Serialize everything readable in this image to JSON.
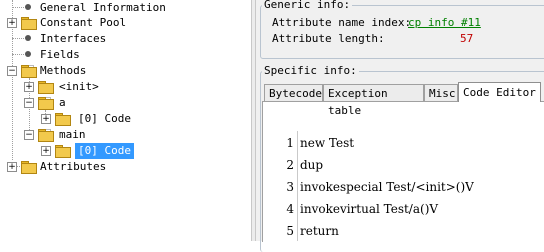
{
  "tree": {
    "items": [
      {
        "label": "General Information"
      },
      {
        "label": "Constant Pool"
      },
      {
        "label": "Interfaces"
      },
      {
        "label": "Fields"
      },
      {
        "label": "Methods"
      },
      {
        "label": "<init>"
      },
      {
        "label": "a"
      },
      {
        "label": "[0] Code"
      },
      {
        "label": "main"
      },
      {
        "label": "[0] Code"
      },
      {
        "label": "Attributes"
      }
    ],
    "expand_glyph": "+",
    "collapse_glyph": "−"
  },
  "generic_info": {
    "legend": "Generic info:",
    "name_index_label": "Attribute name index:",
    "name_index_value": "cp info #11",
    "length_label": "Attribute length:",
    "length_value": "57"
  },
  "specific_info": {
    "legend": "Specific info:",
    "tabs": [
      {
        "label": "Bytecode"
      },
      {
        "label": "Exception table"
      },
      {
        "label": "Misc"
      },
      {
        "label": "Code Editor"
      }
    ],
    "active_tab": "Code Editor"
  },
  "code_lines": [
    {
      "num": "1",
      "text": "new Test"
    },
    {
      "num": "2",
      "text": "dup"
    },
    {
      "num": "3",
      "text": "invokespecial Test/<init>()V"
    },
    {
      "num": "4",
      "text": "invokevirtual Test/a()V"
    },
    {
      "num": "5",
      "text": "return"
    }
  ],
  "colors": {
    "link": "#008000",
    "number": "#c00000",
    "selection": "#3399ff"
  }
}
